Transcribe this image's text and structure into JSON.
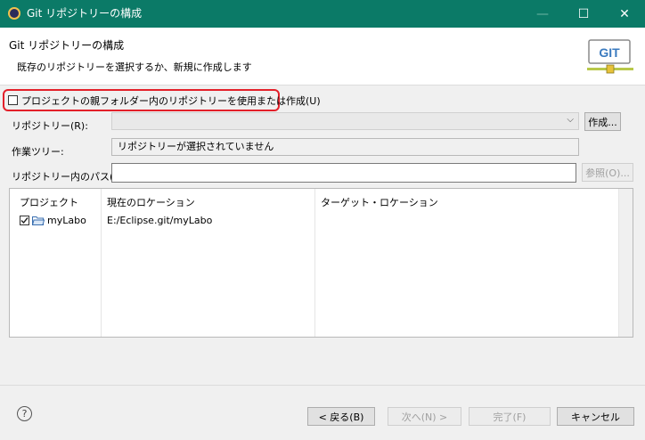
{
  "window": {
    "title": "Git リポジトリーの構成",
    "controls": {
      "minimize": "—",
      "maximize": "☐",
      "close": "✕"
    }
  },
  "header": {
    "title": "Git リポジトリーの構成",
    "description": "既存のリポジトリーを選択するか、新規に作成します",
    "logo_text": "GIT"
  },
  "options": {
    "use_parent_repo_label": "プロジェクトの親フォルダー内のリポジトリーを使用または作成(U)",
    "use_parent_repo_checked": false
  },
  "form": {
    "repository_label": "リポジトリー(R):",
    "repository_value": "",
    "create_button": "作成...",
    "worktree_label": "作業ツリー:",
    "worktree_value": "リポジトリーが選択されていません",
    "path_label": "リポジトリー内のパス(P):",
    "path_value": "",
    "browse_button": "参照(O)..."
  },
  "table": {
    "columns": [
      "プロジェクト",
      "現在のロケーション",
      "ターゲット・ロケーション"
    ],
    "rows": [
      {
        "checked": true,
        "project": "myLabo",
        "current_location": "E:/Eclipse.git/myLabo",
        "target_location": ""
      }
    ]
  },
  "footer": {
    "help_symbol": "?",
    "back_button": "< 戻る(B)",
    "next_button": "次へ(N) >",
    "finish_button": "完了(F)",
    "cancel_button": "キャンセル"
  },
  "colors": {
    "titlebar": "#0b7a67",
    "highlight": "#e3202a"
  }
}
